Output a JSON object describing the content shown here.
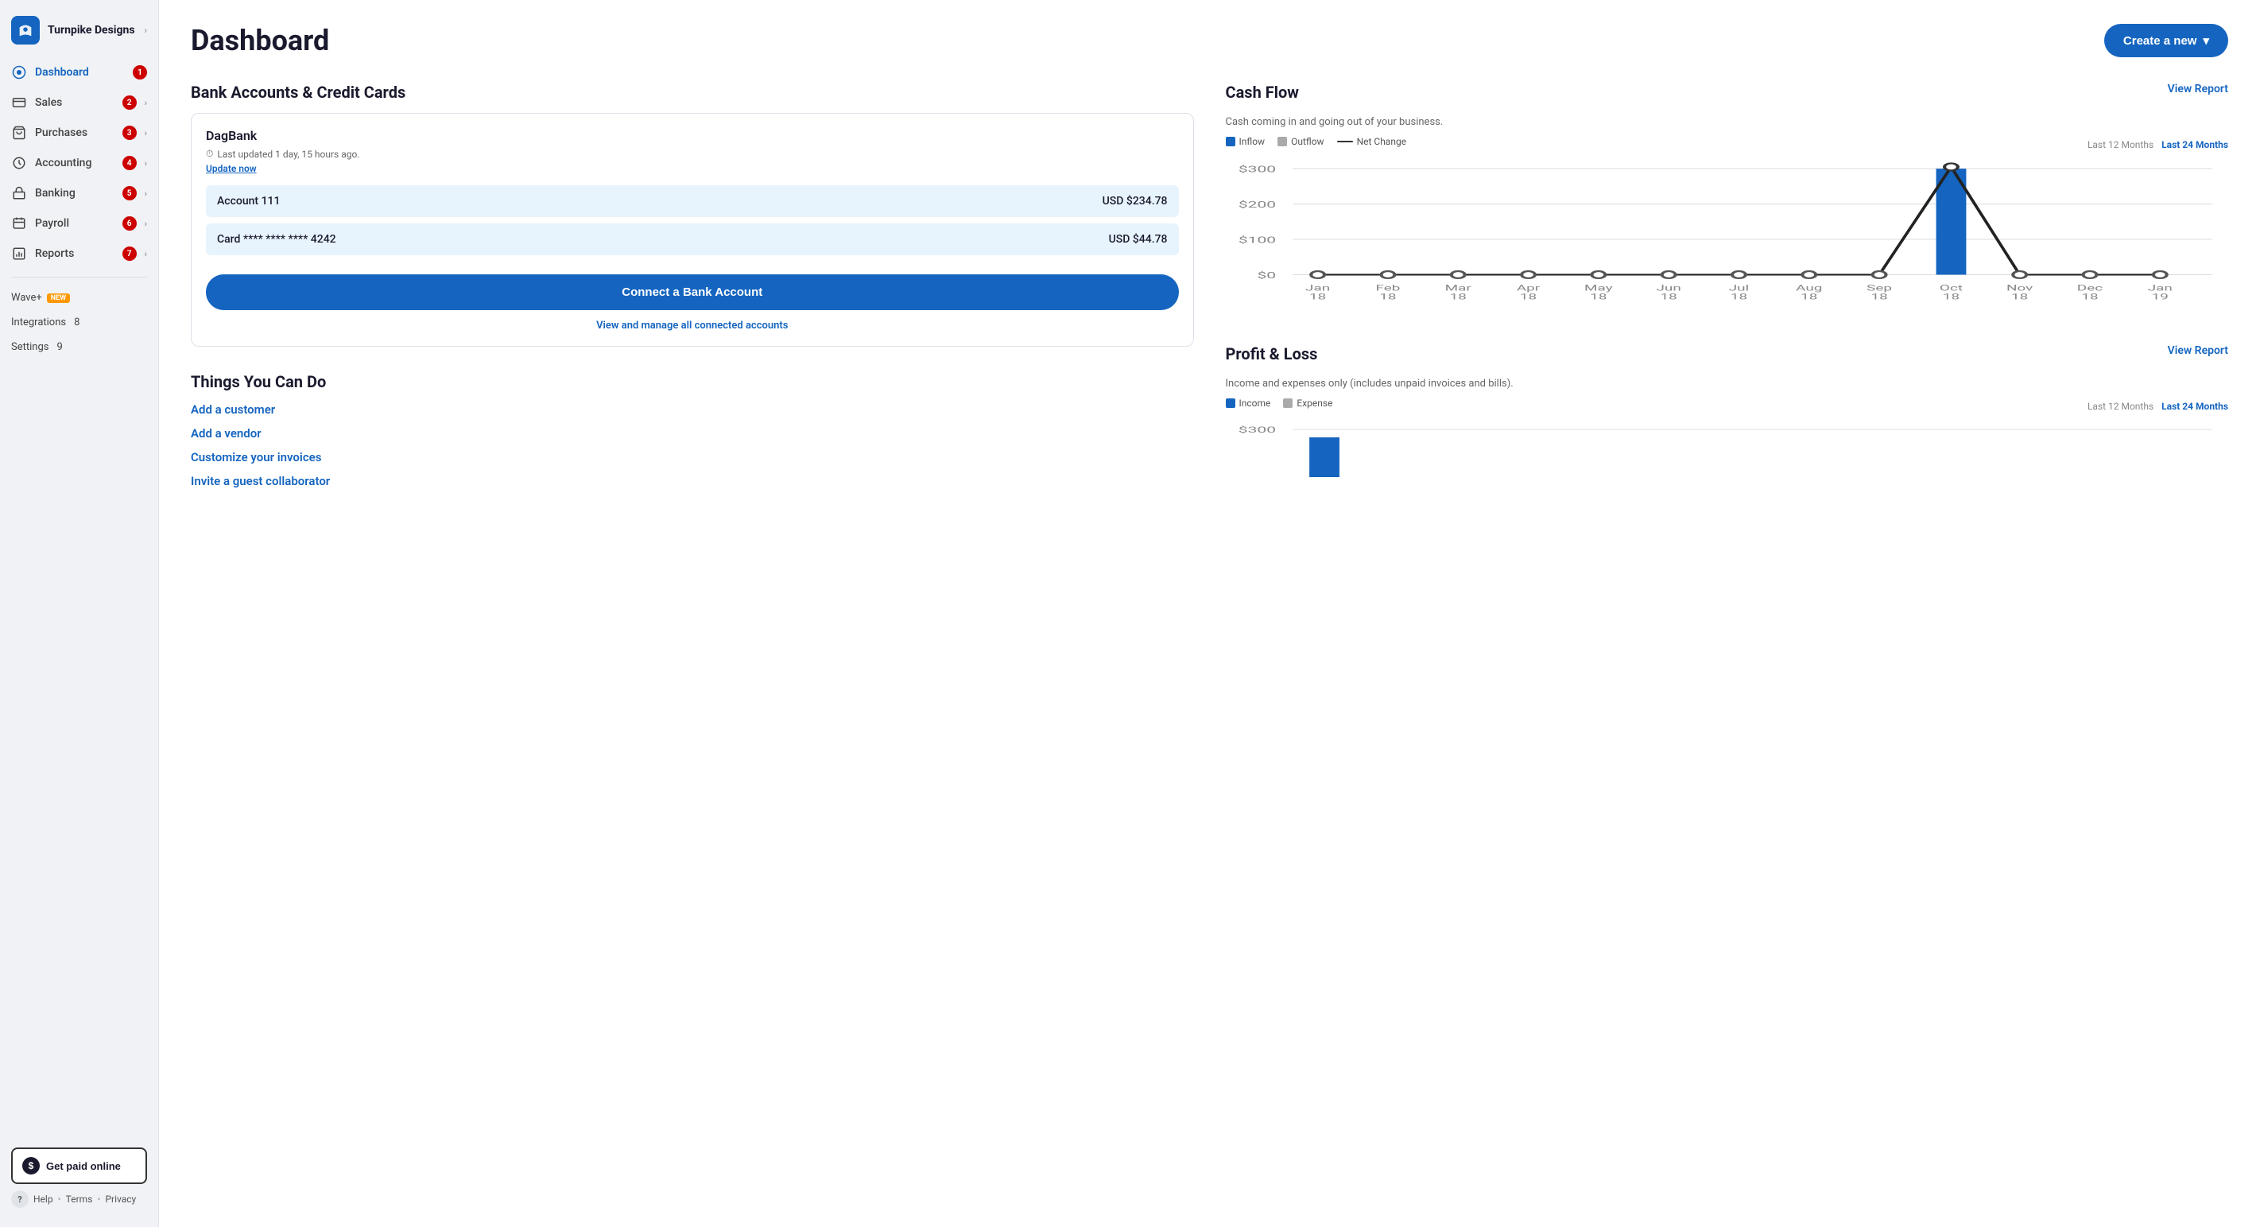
{
  "sidebar": {
    "company": "Turnpike Designs",
    "nav_items": [
      {
        "id": "dashboard",
        "label": "Dashboard",
        "badge": "1",
        "active": true
      },
      {
        "id": "sales",
        "label": "Sales",
        "badge": "2",
        "has_chevron": true
      },
      {
        "id": "purchases",
        "label": "Purchases",
        "badge": "3",
        "has_chevron": true
      },
      {
        "id": "accounting",
        "label": "Accounting",
        "badge": "4",
        "has_chevron": true
      },
      {
        "id": "banking",
        "label": "Banking",
        "badge": "5",
        "has_chevron": true
      },
      {
        "id": "payroll",
        "label": "Payroll",
        "badge": "6",
        "has_chevron": true
      },
      {
        "id": "reports",
        "label": "Reports",
        "badge": "7",
        "has_chevron": true
      }
    ],
    "wave_plus": "Wave+",
    "wave_plus_badge": "NEW",
    "integrations": "Integrations",
    "integrations_badge": "8",
    "settings": "Settings",
    "settings_badge": "9",
    "get_paid_label": "Get paid online",
    "help_label": "Help",
    "terms_label": "Terms",
    "privacy_label": "Privacy"
  },
  "header": {
    "title": "Dashboard",
    "create_btn": "Create a new ▾"
  },
  "bank_section": {
    "title": "Bank Accounts & Credit Cards",
    "bank_name": "DagBank",
    "last_updated": "Last updated 1 day, 15 hours ago.",
    "update_now": "Update now",
    "accounts": [
      {
        "label": "Account 111",
        "amount": "USD $234.78"
      },
      {
        "label": "Card **** **** **** 4242",
        "amount": "USD $44.78"
      }
    ],
    "connect_btn": "Connect a Bank Account",
    "manage_link": "View and manage all connected accounts"
  },
  "things_section": {
    "title": "Things You Can Do",
    "links": [
      "Add a customer",
      "Add a vendor",
      "Customize your invoices",
      "Invite a guest collaborator"
    ]
  },
  "cashflow_section": {
    "title": "Cash Flow",
    "description": "Cash coming in and going out of your business.",
    "view_report": "View Report",
    "legend": {
      "inflow": "Inflow",
      "outflow": "Outflow",
      "net_change": "Net Change"
    },
    "time_filters": [
      "Last 12 Months",
      "Last 24 Months"
    ],
    "active_filter": "Last 12 Months",
    "y_labels": [
      "$300",
      "$200",
      "$100",
      "$0"
    ],
    "x_labels": [
      "Jan\n18",
      "Feb\n18",
      "Mar\n18",
      "Apr\n18",
      "May\n18",
      "Jun\n18",
      "Jul\n18",
      "Aug\n18",
      "Sep\n18",
      "Oct\n18",
      "Nov\n18",
      "Dec\n18",
      "Jan\n19"
    ],
    "bars": [
      0,
      0,
      0,
      0,
      0,
      0,
      0,
      0,
      0,
      100,
      0,
      0,
      0
    ],
    "peak_label": "Oct 18"
  },
  "pl_section": {
    "title": "Profit & Loss",
    "description": "Income and expenses only (includes unpaid invoices and bills).",
    "view_report": "View Report",
    "legend": {
      "income": "Income",
      "expense": "Expense"
    },
    "time_filters": [
      "Last 12 Months",
      "Last 24 Months"
    ],
    "active_filter": "Last 24 Months",
    "y_label": "$300"
  },
  "colors": {
    "primary": "#1565c0",
    "sidebar_bg": "#f0f2f5",
    "accent_red": "#cc0000",
    "account_bg": "#e8f4fd",
    "bar_blue": "#1565c0",
    "bar_gray": "#aaaaaa"
  }
}
